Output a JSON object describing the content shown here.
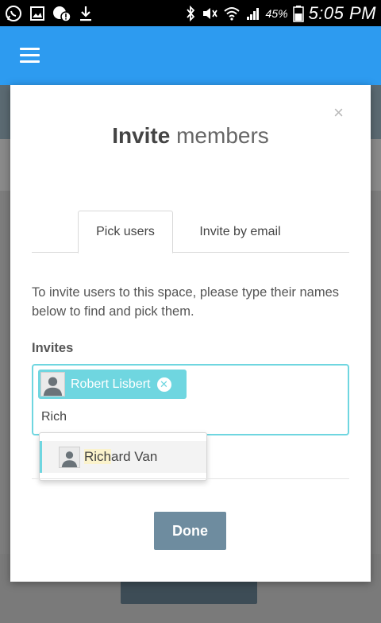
{
  "status_bar": {
    "battery_percent": "45%",
    "time": "5:05 PM"
  },
  "app_bar": {
    "menu_icon": "hamburger-menu-icon"
  },
  "modal": {
    "close_label": "×",
    "title_bold": "Invite",
    "title_rest": "members",
    "tabs": [
      {
        "label": "Pick users",
        "active": true
      },
      {
        "label": "Invite by email",
        "active": false
      }
    ],
    "description": "To invite users to this space, please type their names below to find and pick them.",
    "invites_label": "Invites",
    "selected_user": "Robert Lisbert",
    "search_value": "Rich",
    "suggestion": {
      "match": "Rich",
      "rest": "ard Van"
    },
    "done_label": "Done"
  },
  "colors": {
    "app_bar": "#2d9bf0",
    "accent": "#6fd6e0",
    "done_button": "#6e8c9f"
  }
}
